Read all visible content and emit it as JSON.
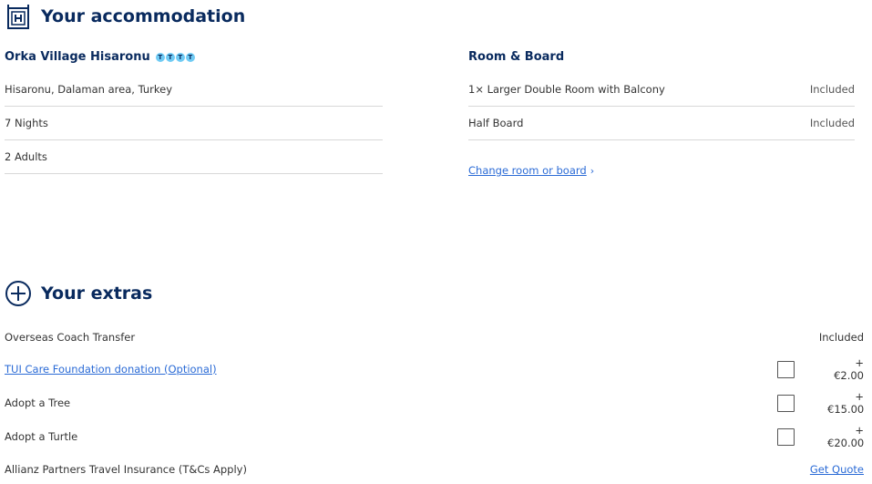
{
  "accommodation": {
    "title": "Your accommodation",
    "icon": "hotel-sign-icon",
    "hotel_name": "Orka Village Hisaronu",
    "rating_glyph": "T",
    "rating_count": 4,
    "details": [
      "Hisaronu, Dalaman area, Turkey",
      "7 Nights",
      "2  Adults"
    ]
  },
  "room_board": {
    "title": "Room & Board",
    "items": [
      {
        "label": "1× Larger Double Room with Balcony",
        "value": "Included"
      },
      {
        "label": "Half Board",
        "value": "Included"
      }
    ],
    "change_link": "Change room or board",
    "change_chevron": "›"
  },
  "extras": {
    "title": "Your extras",
    "icon": "plus-circle-icon",
    "items": [
      {
        "label": "Overseas Coach Transfer",
        "value": "Included",
        "checkbox": false,
        "link": false
      },
      {
        "label": "TUI Care Foundation donation (Optional)",
        "value": "+€2.00",
        "checkbox": true,
        "link": true
      },
      {
        "label": "Adopt a Tree",
        "value": "+€15.00",
        "checkbox": true,
        "link": false
      },
      {
        "label": "Adopt a Turtle",
        "value": "+€20.00",
        "checkbox": true,
        "link": false
      },
      {
        "label": "Allianz Partners Travel Insurance (T&Cs Apply)",
        "value": "Get Quote",
        "checkbox": false,
        "link": false,
        "value_link": true
      }
    ]
  },
  "colors": {
    "brand_navy": "#092a5e",
    "link_blue": "#2b6bd6",
    "rating_blue": "#70cbf4"
  }
}
